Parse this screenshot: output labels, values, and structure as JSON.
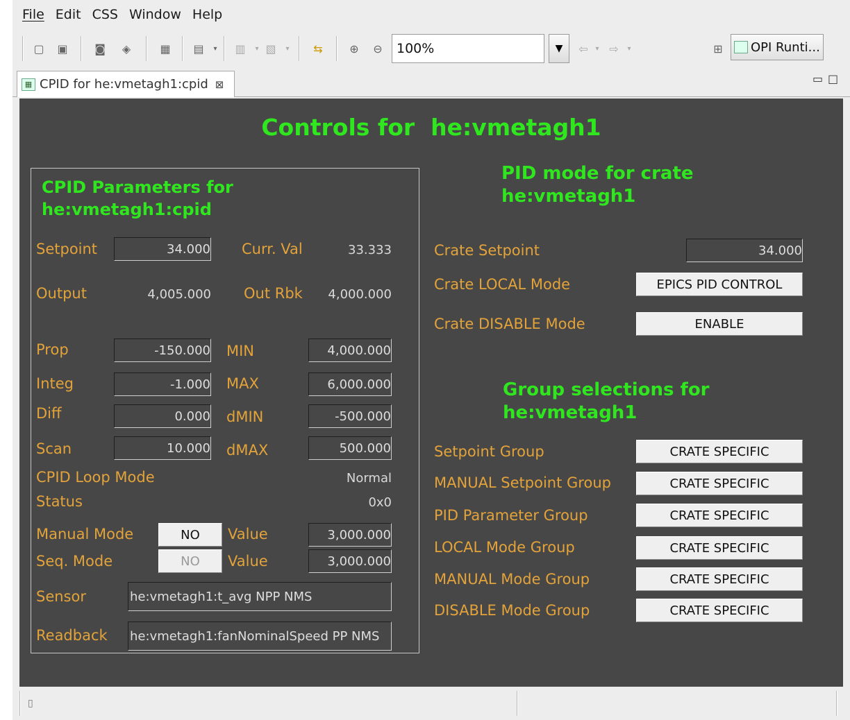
{
  "menu": [
    "File",
    "Edit",
    "CSS",
    "Window",
    "Help"
  ],
  "toolbar": {
    "zoom_value": "100%",
    "perspective_label": "OPI Runti..."
  },
  "tab": {
    "title": "CPID for he:vmetagh1:cpid"
  },
  "display": {
    "title": "Controls for  he:vmetagh1",
    "left_panel": {
      "heading_line1": "CPID Parameters for",
      "heading_line2": "he:vmetagh1:cpid",
      "setpoint_label": "Setpoint",
      "setpoint_value": "34.000",
      "curr_val_label": "Curr. Val",
      "curr_val_value": "33.333",
      "output_label": "Output",
      "output_value": "4,005.000",
      "out_rbk_label": "Out Rbk",
      "out_rbk_value": "4,000.000",
      "prop_label": "Prop",
      "prop_value": "-150.000",
      "min_label": "MIN",
      "min_value": "4,000.000",
      "integ_label": "Integ",
      "integ_value": "-1.000",
      "max_label": "MAX",
      "max_value": "6,000.000",
      "diff_label": "Diff",
      "diff_value": "0.000",
      "dmin_label": "dMIN",
      "dmin_value": "-500.000",
      "scan_label": "Scan",
      "scan_value": "10.000",
      "dmax_label": "dMAX",
      "dmax_value": "500.000",
      "loop_mode_label": "CPID Loop Mode",
      "loop_mode_value": "Normal",
      "status_label": "Status",
      "status_value": "0x0",
      "manual_mode_label": "Manual Mode",
      "manual_mode_button": "NO",
      "manual_value_label": "Value",
      "manual_value": "3,000.000",
      "seq_mode_label": "Seq. Mode",
      "seq_mode_button": "NO",
      "seq_value_label": "Value",
      "seq_value": "3,000.000",
      "sensor_label": "Sensor",
      "sensor_value": "he:vmetagh1:t_avg NPP NMS",
      "readback_label": "Readback",
      "readback_value": "he:vmetagh1:fanNominalSpeed PP NMS"
    },
    "right_panel": {
      "pid_heading_line1": "PID mode for crate",
      "pid_heading_line2": "he:vmetagh1",
      "crate_setpoint_label": "Crate Setpoint",
      "crate_setpoint_value": "34.000",
      "crate_local_label": "Crate LOCAL Mode",
      "crate_local_button": "EPICS PID CONTROL",
      "crate_disable_label": "Crate DISABLE Mode",
      "crate_disable_button": "ENABLE",
      "group_heading_line1": "Group selections for",
      "group_heading_line2": "he:vmetagh1",
      "groups": [
        {
          "label": "Setpoint Group",
          "button": "CRATE SPECIFIC"
        },
        {
          "label": "MANUAL Setpoint Group",
          "button": "CRATE SPECIFIC"
        },
        {
          "label": "PID Parameter Group",
          "button": "CRATE SPECIFIC"
        },
        {
          "label": "LOCAL Mode Group",
          "button": "CRATE SPECIFIC"
        },
        {
          "label": "MANUAL Mode Group",
          "button": "CRATE SPECIFIC"
        },
        {
          "label": "DISABLE Mode Group",
          "button": "CRATE SPECIFIC"
        }
      ]
    }
  },
  "colors": {
    "canvas_bg": "#474747",
    "title_green": "#2fe61f",
    "label_orange": "#e3a33a"
  }
}
